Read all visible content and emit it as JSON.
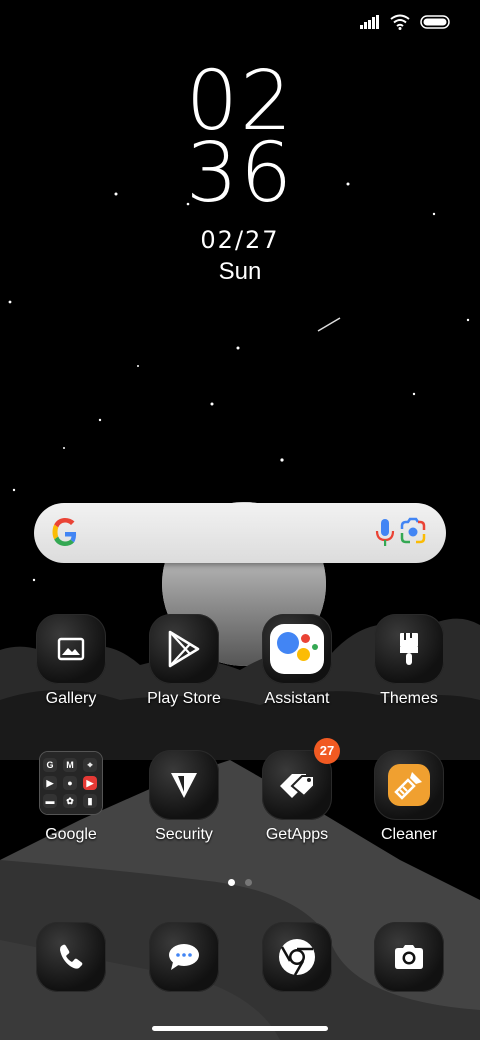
{
  "status_bar": {
    "signal_icon": "signal-icon",
    "wifi_icon": "wifi-icon",
    "battery_icon": "battery-icon"
  },
  "clock": {
    "hour": "02",
    "minute": "36",
    "date": "02/27",
    "day": "Sun"
  },
  "search_bar": {
    "google_icon": "google-g-icon",
    "mic_icon": "mic-icon",
    "lens_icon": "lens-icon"
  },
  "apps_row1": [
    {
      "label": "Gallery",
      "icon": "gallery-icon"
    },
    {
      "label": "Play Store",
      "icon": "play-store-icon"
    },
    {
      "label": "Assistant",
      "icon": "assistant-icon"
    },
    {
      "label": "Themes",
      "icon": "brush-icon"
    }
  ],
  "apps_row2": [
    {
      "label": "Google",
      "icon": "folder"
    },
    {
      "label": "Security",
      "icon": "security-icon"
    },
    {
      "label": "GetApps",
      "icon": "getapps-icon",
      "badge": "27"
    },
    {
      "label": "Cleaner",
      "icon": "cleaner-icon"
    }
  ],
  "folder_items": [
    {
      "glyph": "G",
      "color": "#ffffff",
      "bg": "#333333"
    },
    {
      "glyph": "M",
      "color": "#ffffff",
      "bg": "#333333"
    },
    {
      "glyph": "⌖",
      "color": "#ffffff",
      "bg": "#333333"
    },
    {
      "glyph": "▶",
      "color": "#ffffff",
      "bg": "#333333"
    },
    {
      "glyph": "●",
      "color": "#ffffff",
      "bg": "#333333"
    },
    {
      "glyph": "▶",
      "color": "#ffffff",
      "bg": "#e53935"
    },
    {
      "glyph": "▬",
      "color": "#ffffff",
      "bg": "#333333"
    },
    {
      "glyph": "✿",
      "color": "#ffffff",
      "bg": "#333333"
    },
    {
      "glyph": "▮",
      "color": "#ffffff",
      "bg": "#333333"
    }
  ],
  "dock": [
    {
      "icon": "phone-icon"
    },
    {
      "icon": "messages-icon"
    },
    {
      "icon": "chrome-icon"
    },
    {
      "icon": "camera-icon"
    }
  ],
  "page_indicator": {
    "count": 2,
    "active": 1
  },
  "colors": {
    "badge": "#f15a22",
    "cleaner_orange": "#f0a030"
  }
}
